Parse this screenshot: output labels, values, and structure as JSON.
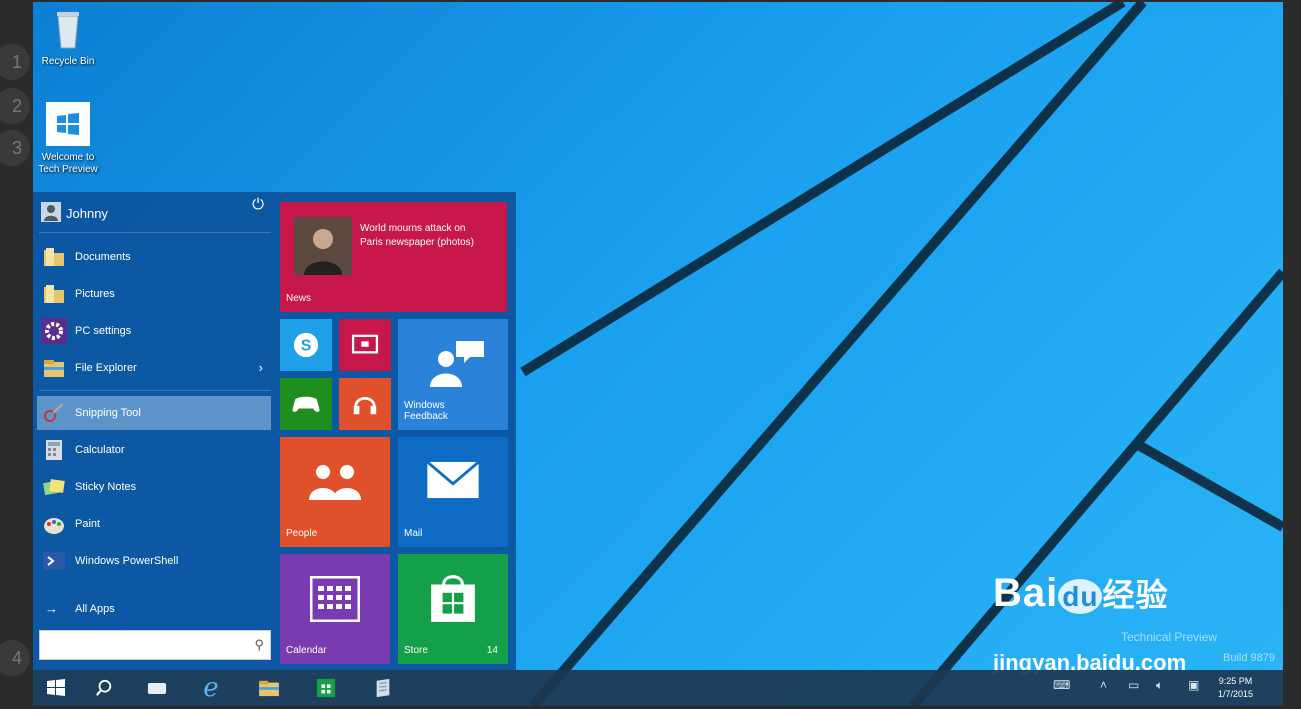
{
  "side_numbers": [
    "1",
    "2",
    "3",
    "4"
  ],
  "desktop": {
    "icons": [
      {
        "label": "Recycle Bin",
        "icon": "recycle-bin-icon"
      },
      {
        "label": "Welcome to Tech Preview",
        "icon": "windows-logo-icon"
      }
    ]
  },
  "start_menu": {
    "user": {
      "name": "Johnny"
    },
    "places": [
      {
        "label": "Documents",
        "icon": "folder-icon"
      },
      {
        "label": "Pictures",
        "icon": "folder-icon"
      },
      {
        "label": "PC settings",
        "icon": "gear-icon"
      },
      {
        "label": "File Explorer",
        "icon": "file-explorer-icon"
      }
    ],
    "apps": [
      {
        "label": "Snipping Tool",
        "icon": "snipping-tool-icon"
      },
      {
        "label": "Calculator",
        "icon": "calculator-icon"
      },
      {
        "label": "Sticky Notes",
        "icon": "sticky-notes-icon"
      },
      {
        "label": "Paint",
        "icon": "paint-icon"
      },
      {
        "label": "Windows PowerShell",
        "icon": "powershell-icon"
      }
    ],
    "all_apps_label": "All Apps",
    "search": {
      "placeholder": "",
      "value": ""
    }
  },
  "tiles": {
    "news": {
      "headline": "World mourns attack on Paris newspaper (photos)",
      "label": "News",
      "color": "#c8174a"
    },
    "skype": {
      "color": "#1ea0e8"
    },
    "video": {
      "color": "#c8174a"
    },
    "games": {
      "color": "#1e8f1e"
    },
    "music": {
      "color": "#e0502a"
    },
    "feedback": {
      "label": "Windows Feedback",
      "color": "#2b82d9"
    },
    "people": {
      "label": "People",
      "color": "#e0502a"
    },
    "mail": {
      "label": "Mail",
      "color": "#0f6cc4"
    },
    "calendar": {
      "label": "Calendar",
      "color": "#7b3bb0"
    },
    "store": {
      "label": "Store",
      "badge": "14",
      "color": "#14a049"
    }
  },
  "watermark": {
    "line1": "Technical Preview",
    "line2": "Build 9879",
    "logo_text": "Bai",
    "logo_du": "du",
    "logo_cn": "经验",
    "url": "jingyan.baidu.com"
  },
  "taskbar": {
    "time": "9:25 PM",
    "date": "1/7/2015"
  }
}
